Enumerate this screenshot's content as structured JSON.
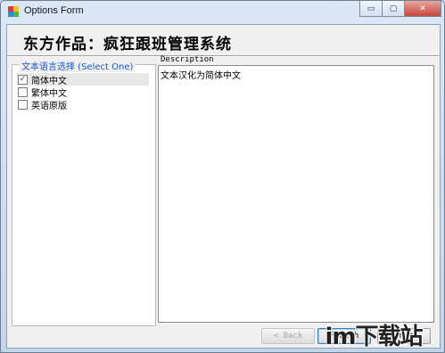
{
  "window": {
    "title": "Options Form",
    "controls": {
      "minimize": "▭",
      "maximize": "▢",
      "close": "✕"
    }
  },
  "header": {
    "title": "东方作品：疯狂跟班管理系统"
  },
  "language_group": {
    "legend": "文本语言选择 (Select One)",
    "options": [
      {
        "label": "简体中文",
        "checked": true
      },
      {
        "label": "繁体中文",
        "checked": false
      },
      {
        "label": "英语原版",
        "checked": false
      }
    ]
  },
  "description": {
    "label": "Description",
    "text": "文本汉化为简体中文"
  },
  "buttons": {
    "back": "< Back",
    "finish": "Finish",
    "cancel": "Cancel"
  },
  "watermark": {
    "text": "im下载站"
  }
}
